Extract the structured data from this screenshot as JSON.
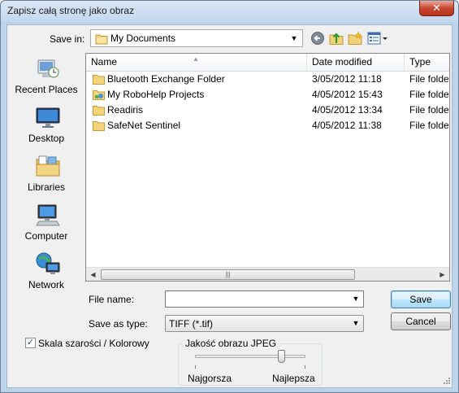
{
  "window": {
    "title": "Zapisz całą stronę jako obraz",
    "close_label": "✕"
  },
  "toolbar": {
    "save_in_label": "Save in:",
    "save_in_value": "My Documents",
    "icons": [
      "back-icon",
      "up-folder-icon",
      "new-folder-icon",
      "view-menu-icon"
    ]
  },
  "places": [
    {
      "label": "Recent Places",
      "icon": "recent-places-icon"
    },
    {
      "label": "Desktop",
      "icon": "desktop-icon"
    },
    {
      "label": "Libraries",
      "icon": "libraries-icon"
    },
    {
      "label": "Computer",
      "icon": "computer-icon"
    },
    {
      "label": "Network",
      "icon": "network-icon"
    }
  ],
  "filelist": {
    "columns": [
      "Name",
      "Date modified",
      "Type"
    ],
    "rows": [
      {
        "name": "Bluetooth Exchange Folder",
        "date": "3/05/2012 11:18",
        "type": "File folder",
        "icon": "folder-icon"
      },
      {
        "name": "My RoboHelp Projects",
        "date": "4/05/2012 15:43",
        "type": "File folder",
        "icon": "special-folder-icon"
      },
      {
        "name": "Readiris",
        "date": "4/05/2012 13:34",
        "type": "File folder",
        "icon": "folder-icon"
      },
      {
        "name": "SafeNet Sentinel",
        "date": "4/05/2012 11:38",
        "type": "File folder",
        "icon": "folder-icon"
      }
    ]
  },
  "form": {
    "file_name_label": "File name:",
    "file_name_value": "",
    "save_as_type_label": "Save as type:",
    "save_as_type_value": "TIFF (*.tif)",
    "save_button": "Save",
    "cancel_button": "Cancel"
  },
  "options": {
    "grayscale_label": "Skala szarości / Kolorowy",
    "grayscale_checked": true,
    "jpeg_group_title": "Jakość obrazu JPEG",
    "jpeg_quality_fraction": 0.78,
    "jpeg_min_label": "Najgorsza",
    "jpeg_max_label": "Najlepsza"
  }
}
